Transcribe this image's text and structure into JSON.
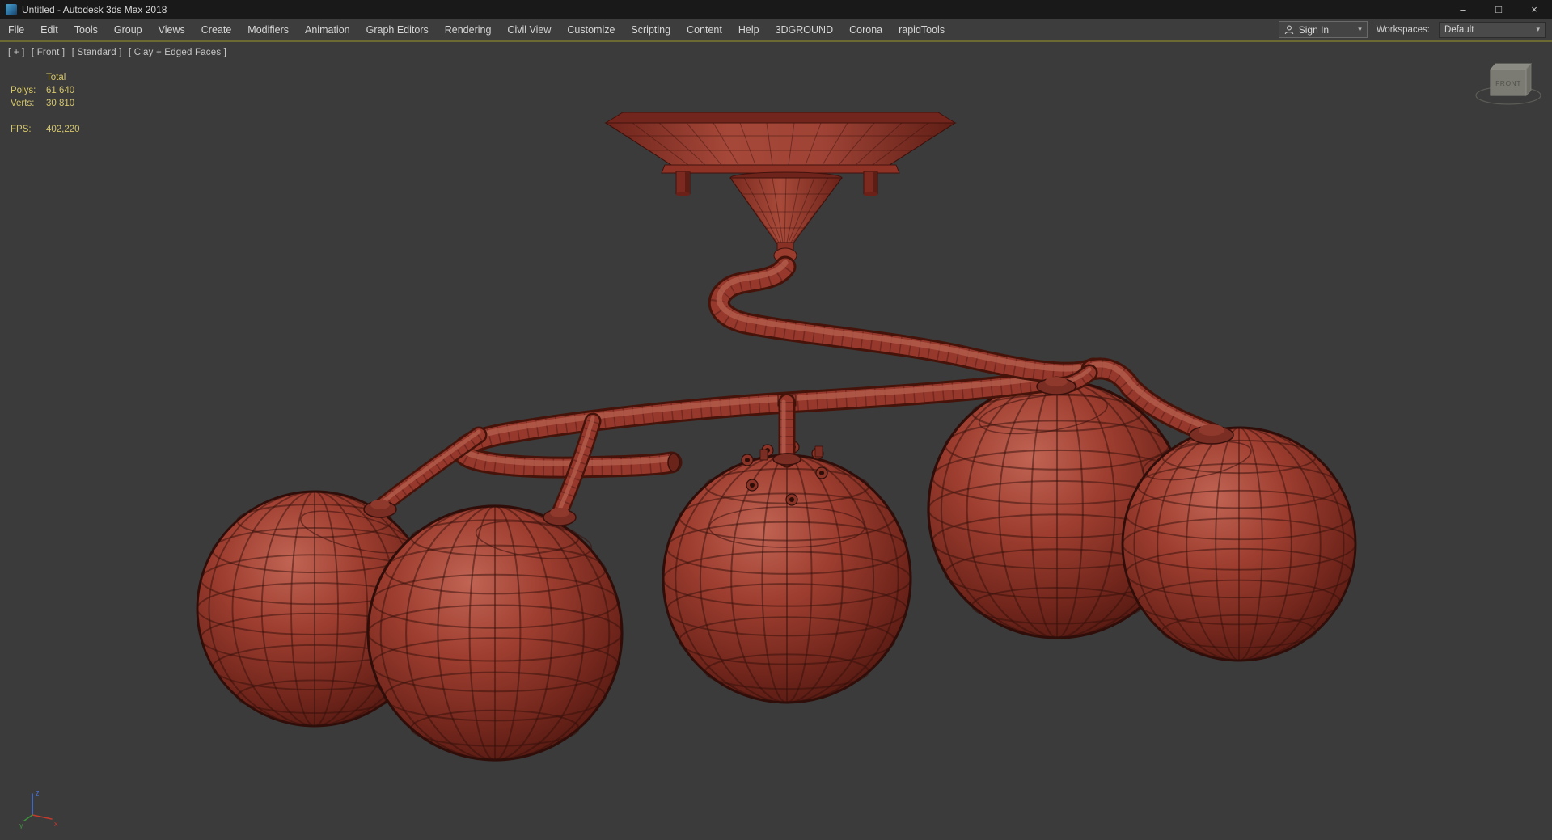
{
  "window": {
    "title": "Untitled - Autodesk 3ds Max 2018",
    "minimize_glyph": "–",
    "maximize_glyph": "□",
    "close_glyph": "×"
  },
  "menu_bar": {
    "items": [
      "File",
      "Edit",
      "Tools",
      "Group",
      "Views",
      "Create",
      "Modifiers",
      "Animation",
      "Graph Editors",
      "Rendering",
      "Civil View",
      "Customize",
      "Scripting",
      "Content",
      "Help",
      "3DGROUND",
      "Corona",
      "rapidTools"
    ],
    "sign_in_label": "Sign In",
    "workspaces_label": "Workspaces:",
    "workspace_value": "Default",
    "caret_glyph": "▾"
  },
  "viewport": {
    "label_segments": [
      "[ + ]",
      "[ Front ]",
      "[ Standard ]",
      "[ Clay + Edged Faces ]"
    ],
    "stats": {
      "header": "Total",
      "polys_label": "Polys:",
      "polys_value": "61 640",
      "verts_label": "Verts:",
      "verts_value": "30 810",
      "fps_label": "FPS:",
      "fps_value": "402,220"
    },
    "viewcube_label": "FRONT",
    "axis": {
      "x": "x",
      "y": "y",
      "z": "z"
    }
  },
  "colors": {
    "titlebar_bg": "#191919",
    "menubar_bg": "#3d3d3d",
    "accent_line": "#6b6a33",
    "viewport_bg": "#3b3b3b",
    "model_red": "#9c3c2f",
    "model_highlight": "#b45e4e",
    "model_shadow": "#4e1710",
    "stats_text": "#d6c76a"
  }
}
